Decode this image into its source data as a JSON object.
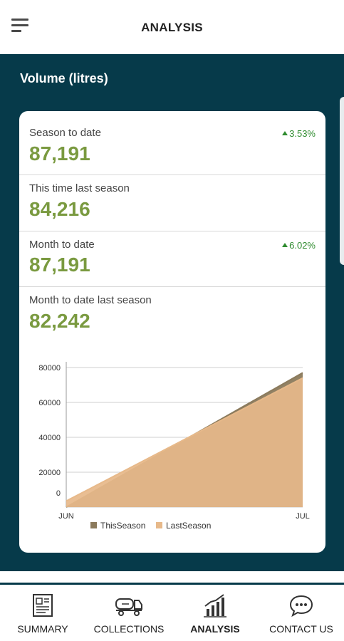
{
  "header": {
    "title": "ANALYSIS"
  },
  "panel": {
    "title": "Volume (litres)"
  },
  "stats": [
    {
      "label": "Season to date",
      "value": "87,191",
      "change": "3.53%"
    },
    {
      "label": "This time last season",
      "value": "84,216"
    },
    {
      "label": "Month to date",
      "value": "87,191",
      "change": "6.02%"
    },
    {
      "label": "Month to date last season",
      "value": "82,242"
    }
  ],
  "chart_data": {
    "type": "area",
    "x": [
      "JUN",
      "JUL"
    ],
    "x_ticks": [
      "JUN",
      "JUL"
    ],
    "y_ticks": [
      "80000",
      "60000",
      "40000",
      "20000",
      "0"
    ],
    "ylim": [
      0,
      80000
    ],
    "series": [
      {
        "name": "ThisSeason",
        "values": [
          0,
          77000
        ],
        "color": "#8b7a5c"
      },
      {
        "name": "LastSeason",
        "values": [
          3500,
          74000
        ],
        "color": "#e7b98a"
      }
    ],
    "legend": "bottom"
  },
  "bottom_nav": {
    "items": [
      {
        "label": "SUMMARY",
        "icon": "document-icon"
      },
      {
        "label": "COLLECTIONS",
        "icon": "tanker-truck-icon"
      },
      {
        "label": "ANALYSIS",
        "icon": "bar-chart-icon",
        "active": true
      },
      {
        "label": "CONTACT US",
        "icon": "chat-bubble-icon"
      }
    ]
  },
  "colors": {
    "panel": "#063a4a",
    "value": "#7a9a40",
    "positive": "#2e8b2e"
  }
}
